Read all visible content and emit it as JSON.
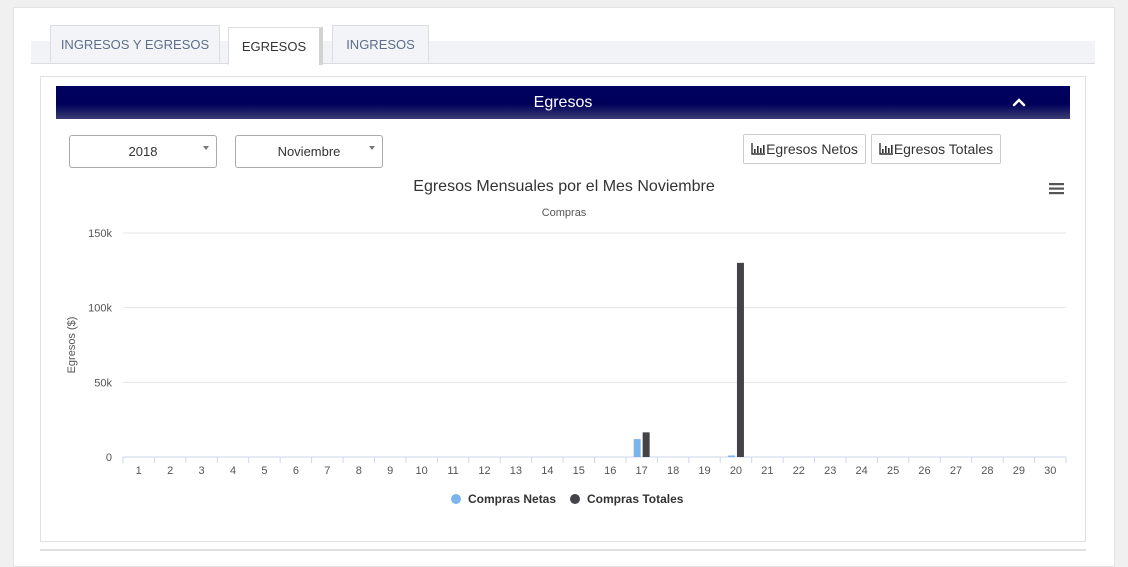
{
  "tabs": [
    {
      "label": "INGRESOS Y EGRESOS",
      "active": false
    },
    {
      "label": "EGRESOS",
      "active": true
    },
    {
      "label": "INGRESOS",
      "active": false
    }
  ],
  "panel": {
    "title": "Egresos"
  },
  "filters": {
    "year": "2018",
    "month": "Noviembre"
  },
  "buttons": {
    "netos": "Egresos Netos",
    "totales": "Egresos Totales"
  },
  "colors": {
    "netas": "#7cb5ec",
    "totales": "#434348",
    "header": "#000060"
  },
  "chart_data": {
    "type": "bar",
    "title": "Egresos Mensuales por el Mes Noviembre",
    "subtitle": "Compras",
    "ylabel": "Egresos ($)",
    "xlabel": "",
    "ylim": [
      0,
      150000
    ],
    "yticks": [
      "0",
      "50k",
      "100k",
      "150k"
    ],
    "ytick_values": [
      0,
      50000,
      100000,
      150000
    ],
    "categories": [
      "1",
      "2",
      "3",
      "4",
      "5",
      "6",
      "7",
      "8",
      "9",
      "10",
      "11",
      "12",
      "13",
      "14",
      "15",
      "16",
      "17",
      "18",
      "19",
      "20",
      "21",
      "22",
      "23",
      "24",
      "25",
      "26",
      "27",
      "28",
      "29",
      "30"
    ],
    "series": [
      {
        "name": "Compras Netas",
        "values": [
          0,
          0,
          0,
          0,
          0,
          0,
          0,
          0,
          0,
          0,
          0,
          0,
          0,
          0,
          0,
          0,
          12000,
          0,
          0,
          1000,
          0,
          0,
          0,
          0,
          0,
          0,
          0,
          0,
          0,
          0
        ]
      },
      {
        "name": "Compras Totales",
        "values": [
          0,
          0,
          0,
          0,
          0,
          0,
          0,
          0,
          0,
          0,
          0,
          0,
          0,
          0,
          0,
          0,
          16500,
          0,
          0,
          130000,
          0,
          0,
          0,
          0,
          0,
          0,
          0,
          0,
          0,
          0
        ]
      }
    ],
    "legend": "bottom-center",
    "grid": true
  }
}
